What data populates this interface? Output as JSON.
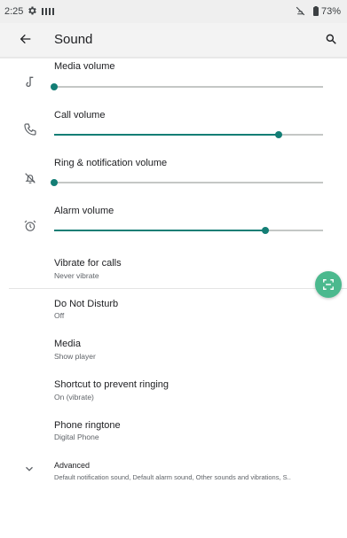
{
  "status_bar": {
    "time": "2:25",
    "battery": "73%"
  },
  "header": {
    "title": "Sound"
  },
  "volume": [
    {
      "label": "Media volume",
      "level": 0.0
    },
    {
      "label": "Call volume",
      "level": 0.835
    },
    {
      "label": "Ring & notification volume",
      "level": 0.0
    },
    {
      "label": "Alarm volume",
      "level": 0.785
    }
  ],
  "settings": {
    "vibrate": {
      "title": "Vibrate for calls",
      "summary": "Never vibrate"
    },
    "dnd": {
      "title": "Do Not Disturb",
      "summary": "Off"
    },
    "media": {
      "title": "Media",
      "summary": "Show player"
    },
    "shortcut": {
      "title": "Shortcut to prevent ringing",
      "summary": "On (vibrate)"
    },
    "ringtone": {
      "title": "Phone ringtone",
      "summary": "Digital Phone"
    },
    "advanced": {
      "title": "Advanced",
      "summary": "Default notification sound, Default alarm sound, Other sounds and vibrations, S.."
    }
  },
  "colors": {
    "accent": "#137e75",
    "fab": "#4bb98e",
    "track": "#c4c7c5"
  }
}
